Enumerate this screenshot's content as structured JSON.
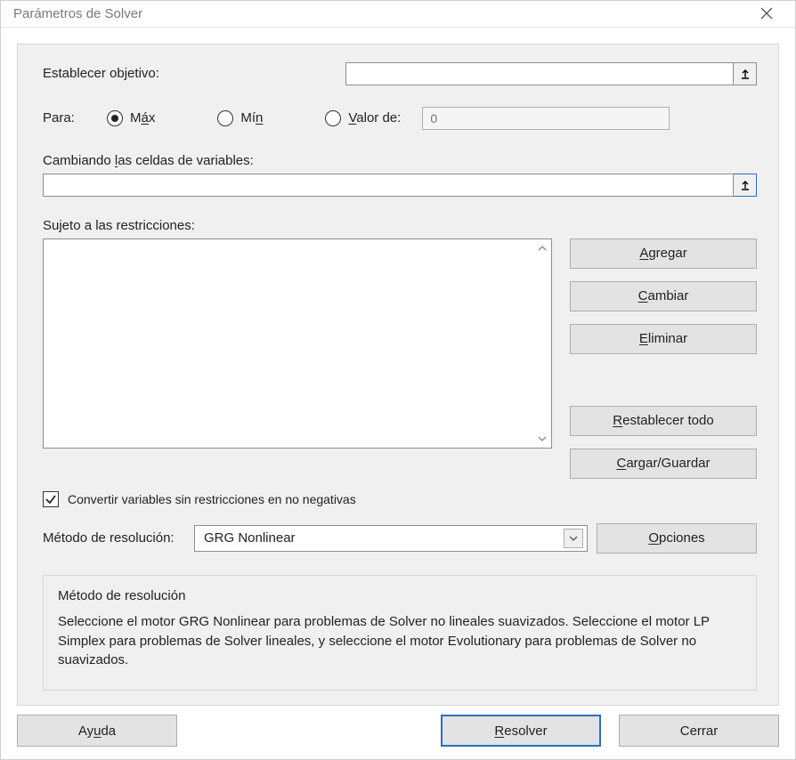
{
  "window": {
    "title": "Parámetros de Solver",
    "close_icon": "×"
  },
  "objective": {
    "label": "Establecer objetivo:",
    "value": "",
    "ref_icon": "↥"
  },
  "para": {
    "label": "Para:",
    "options": {
      "max_pre": "M",
      "max_u": "á",
      "max_post": "x",
      "min_pre": "Mí",
      "min_u": "n",
      "min_post": "",
      "val_pre": "",
      "val_u": "V",
      "val_post": "alor de:"
    },
    "selected": "max",
    "value_de": "0"
  },
  "vars": {
    "label_pre": "Cambiando ",
    "label_u": "l",
    "label_post": "as celdas de variables:",
    "value": "",
    "ref_icon": "↥"
  },
  "constraints": {
    "label": "Sujeto a las restricciones:"
  },
  "side_buttons": {
    "add_u": "A",
    "add_post": "gregar",
    "change_u": "C",
    "change_post": "ambiar",
    "delete_u": "E",
    "delete_post": "liminar",
    "reset_u": "R",
    "reset_post": "establecer todo",
    "loadsave_u": "C",
    "loadsave_post": "argar/Guardar"
  },
  "nonneg": {
    "checked": true,
    "label": "Convertir variables sin restricciones en no negativas"
  },
  "method": {
    "label": "Método de resolución:",
    "selected": "GRG Nonlinear",
    "options_u": "O",
    "options_post": "pciones"
  },
  "help_box": {
    "title": "Método de resolución",
    "text": "Seleccione el motor GRG Nonlinear para problemas de Solver no lineales suavizados. Seleccione el motor LP Simplex para problemas de Solver lineales, y seleccione el motor Evolutionary para problemas de Solver no suavizados."
  },
  "footer": {
    "help_u": "Ay",
    "help_u2": "u",
    "help_post": "da",
    "solve_u": "R",
    "solve_post": "esolver",
    "close": "Cerrar"
  }
}
